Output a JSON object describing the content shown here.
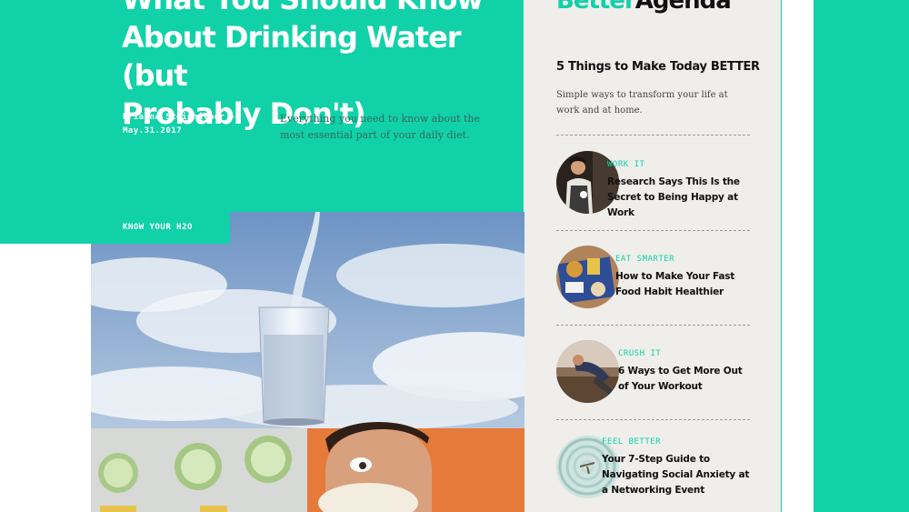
{
  "article": {
    "headline_line1": "What You Should Know",
    "headline_line2": "About Drinking Water (but",
    "headline_line3": "Probably Don't)",
    "author": "Brianna Steinhilber -",
    "date": "May.31.2017",
    "dek": "Everything you need to know about the most essential part of your daily diet.",
    "tag": "KNOW YOUR H2O"
  },
  "sidebar": {
    "brand_part1": "Better",
    "brand_part2": "Agenda",
    "title": "5 Things to Make Today BETTER",
    "subtitle": "Simple ways to transform your life at work and at home.",
    "items": [
      {
        "category": "WORK IT",
        "title": "Research Says This Is the Secret to Being Happy at Work",
        "icon": "man-apron-photo"
      },
      {
        "category": "EAT SMARTER",
        "title": "How to Make Your Fast Food Habit Healthier",
        "icon": "fast-food-tray-photo"
      },
      {
        "category": "CRUSH IT",
        "title": "6 Ways to Get More Out of Your Workout",
        "icon": "workout-photo"
      },
      {
        "category": "FEEL BETTER",
        "title": "Your 7-Step Guide to Navigating Social Anxiety at a Networking Event",
        "icon": "spiral-photo"
      }
    ]
  },
  "colors": {
    "accent": "#11d1a8",
    "sidebar_bg": "#efeeeb",
    "text_dark": "#111111"
  }
}
